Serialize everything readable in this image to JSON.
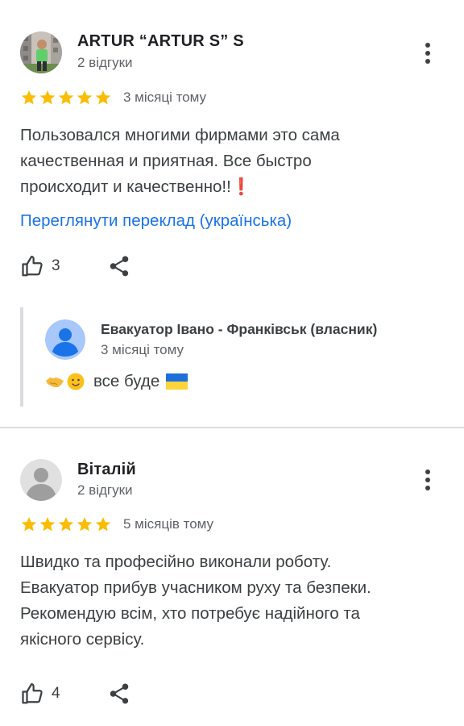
{
  "reviews": [
    {
      "author": "ARTUR “ARTUR S” S",
      "meta": "2 відгуки",
      "rating": 5,
      "time": "3 місяці тому",
      "text_lines": [
        "Пользовался многими фирмами это сама",
        "качественная и приятная. Все быстро",
        "происходит и качественно!!"
      ],
      "text_end_emoji": "❗",
      "translate_link": "Переглянути переклад (українська)",
      "likes": "3",
      "owner_reply": {
        "name": "Евакуатор Івано - Франківськ (власник)",
        "time": "3 місяці тому",
        "text": "все буде"
      }
    },
    {
      "author": "Віталій",
      "meta": "2 відгуки",
      "rating": 5,
      "time": "5 місяців тому",
      "text_lines": [
        "Швидко та професійно виконали роботу.",
        "Евакуатор прибув учасником руху та безпеки.",
        "Рекомендую всім, хто потребує надійного та",
        "якісного сервісу."
      ],
      "likes": "4"
    }
  ],
  "colors": {
    "star": "#fbbc04",
    "link": "#1a73e8",
    "divider": "#dadce0",
    "secondary_text": "#5f6368"
  },
  "icons": {
    "more": "more-vert-icon",
    "like": "thumb-up-icon",
    "share": "share-icon",
    "star": "star-icon"
  }
}
